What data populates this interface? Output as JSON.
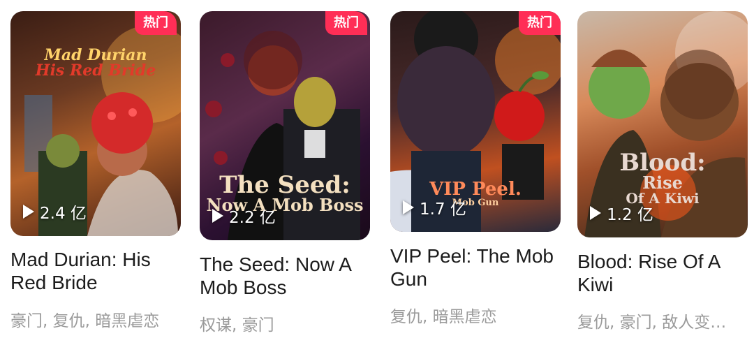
{
  "cards": [
    {
      "title": "Mad Durian: His Red Bride",
      "tags": "豪门, 复仇, 暗黑虐恋",
      "views": "2.4 亿",
      "badge": "热门",
      "poster_text_1": "Mad Durian",
      "poster_text_2": "His Red Bride"
    },
    {
      "title": "The Seed: Now A Mob Boss",
      "tags": "权谋, 豪门",
      "views": "2.2 亿",
      "badge": "热门",
      "poster_text_1": "The Seed:",
      "poster_text_2": "Now A Mob Boss"
    },
    {
      "title": "VIP Peel: The Mob Gun",
      "tags": "复仇, 暗黑虐恋",
      "views": "1.7 亿",
      "badge": "热门",
      "poster_text_1": "VIP Peel.",
      "poster_text_2": "Mob Gun"
    },
    {
      "title": "Blood: Rise Of A Kiwi",
      "tags": "复仇, 豪门, 敌人变…",
      "views": "1.2 亿",
      "poster_text_1": "Blood:",
      "poster_text_2": "Rise",
      "poster_text_3": "Of A Kiwi"
    }
  ],
  "colors": {
    "badge": "#ff2e56",
    "title": "#1c1c1c",
    "tags": "#9a9a9a"
  },
  "icons": {
    "play": "play-icon"
  }
}
